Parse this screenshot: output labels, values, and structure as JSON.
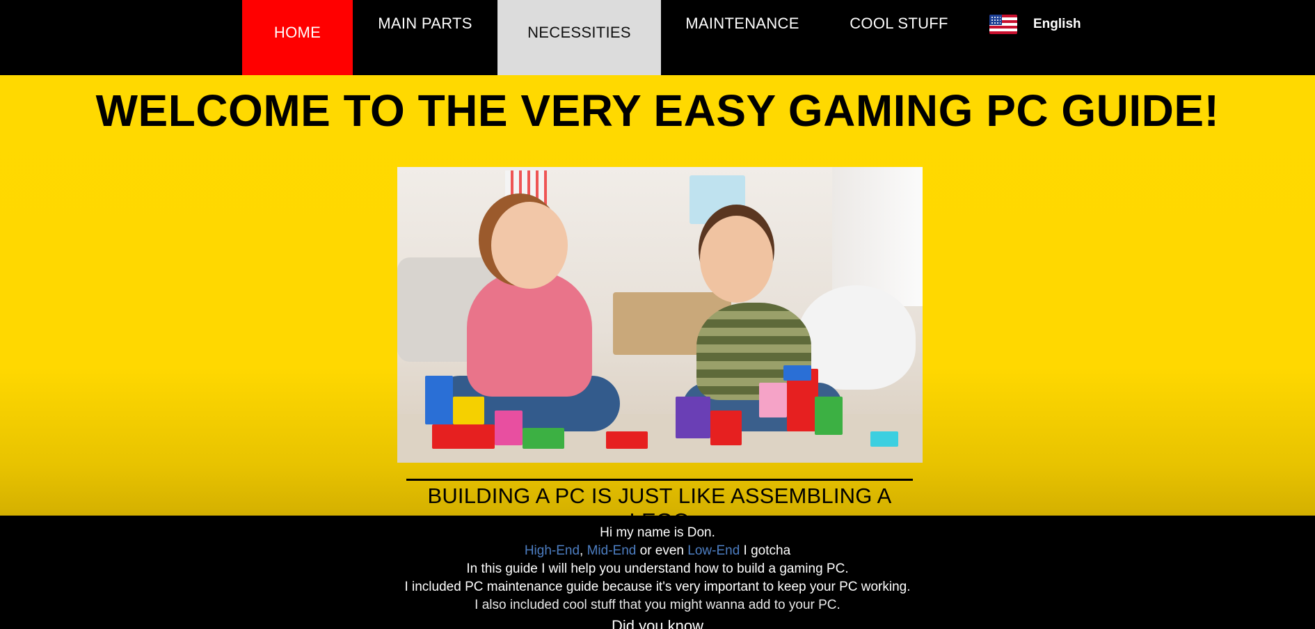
{
  "nav": {
    "items": [
      {
        "label": "HOME",
        "active": true,
        "color": "#ff0000"
      },
      {
        "label": "MAIN PARTS"
      },
      {
        "label": "NECESSITIES",
        "hover": true,
        "color": "#dcdcdc"
      },
      {
        "label": "MAINTENANCE"
      },
      {
        "label": "COOL STUFF"
      }
    ],
    "language": {
      "label": "English",
      "icon": "us-flag-icon"
    }
  },
  "hero": {
    "title": "WELCOME TO THE VERY EASY GAMING PC GUIDE!",
    "tagline": "BUILDING A PC IS JUST LIKE ASSEMBLING A LEGO",
    "background_color": "#ffd900"
  },
  "intro": {
    "line1": "Hi my name is Don.",
    "line2_links": [
      "High-End",
      "Mid-End",
      "Low-End"
    ],
    "line2_sep1": ",",
    "line2_mid": " or even ",
    "line2_end": " I gotcha",
    "line3": "In this guide I will help you understand how to build a gaming PC.",
    "line4": "I included PC maintenance guide because it's very important to keep your PC working.",
    "line5": "I also included cool stuff that you might wanna add to your PC.",
    "line6": "Did you know",
    "link_color": "#4d7ec2"
  }
}
